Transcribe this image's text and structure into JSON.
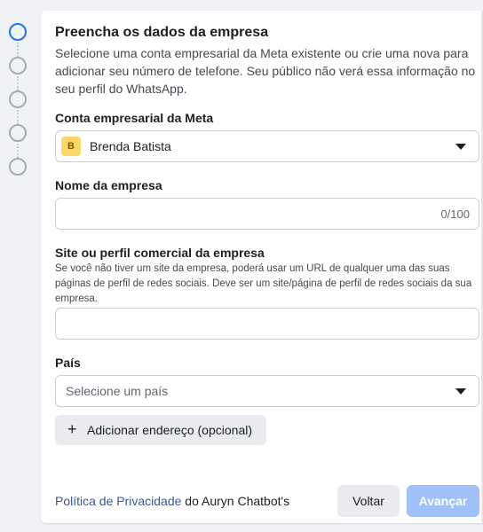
{
  "stepper": {
    "steps": [
      {
        "state": "active"
      },
      {
        "state": "pending"
      },
      {
        "state": "pending"
      },
      {
        "state": "pending"
      },
      {
        "state": "pending"
      }
    ]
  },
  "form": {
    "title": "Preencha os dados da empresa",
    "subtitle": "Selecione uma conta empresarial da Meta existente ou crie uma nova para adicionar seu número de telefone. Seu público não verá essa informação no seu perfil do WhatsApp.",
    "meta_account": {
      "label": "Conta empresarial da Meta",
      "badge_letter": "B",
      "selected": "Brenda Batista"
    },
    "company_name": {
      "label": "Nome da empresa",
      "value": "",
      "counter": "0/100"
    },
    "website": {
      "label": "Site ou perfil comercial da empresa",
      "help": "Se você não tiver um site da empresa, poderá usar um URL de qualquer uma das suas páginas de perfil de redes sociais. Deve ser um site/página de perfil de redes sociais da sua empresa.",
      "value": ""
    },
    "country": {
      "label": "País",
      "placeholder": "Selecione um país"
    },
    "add_address_label": "Adicionar endereço (opcional)"
  },
  "footer": {
    "privacy_link": "Política de Privacidade",
    "privacy_suffix": " do Auryn Chatbot's",
    "back_label": "Voltar",
    "next_label": "Avançar"
  },
  "colors": {
    "accent": "#1877f2",
    "primary_disabled": "#9fc1f7",
    "link": "#385898",
    "badge": "#fbd866"
  }
}
